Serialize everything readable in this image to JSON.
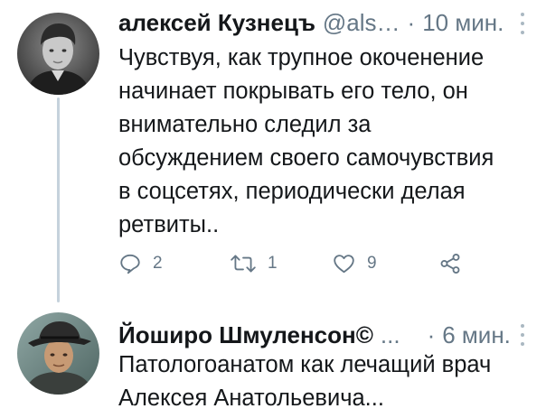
{
  "tweets": [
    {
      "author_name": "алексей Кузнецъ",
      "handle": "@als…",
      "separator": "·",
      "time": "10 мин.",
      "text": "Чувствуя, как трупное окоченение\nначинает покрывать его тело, он\nвнимательно следил за\nобсуждением своего самочувствия\nв соцсетях, периодически делая\nретвиты..",
      "actions": {
        "reply_count": "2",
        "retweet_count": "1",
        "like_count": "9"
      },
      "icons": [
        "reply-icon",
        "retweet-icon",
        "like-icon",
        "share-icon",
        "more-icon"
      ]
    },
    {
      "author_name": "Йоширо Шмуленсон©",
      "handle": "...",
      "separator": "·",
      "time": "6 мин.",
      "text": "Патологоанатом как лечащий врач\nАлексея Анатольевича...",
      "icons": [
        "more-icon"
      ]
    }
  ],
  "colors": {
    "text": "#14171a",
    "secondary": "#657786",
    "thread_line": "#c5d2dc"
  }
}
